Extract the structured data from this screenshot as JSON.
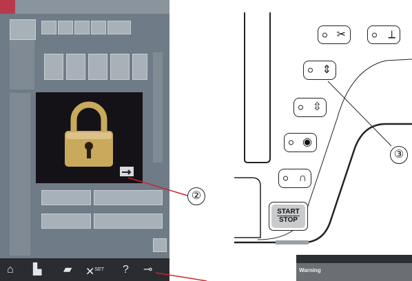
{
  "screen": {
    "bottom_bar": {
      "home_icon": "home-icon",
      "sewing_icon": "sewing-icon",
      "folder_icon": "folder-icon",
      "settings_label": "SET",
      "help_label": "?",
      "key_icon": "key-icon"
    }
  },
  "callouts": {
    "two": "②",
    "three": "③"
  },
  "buttons": {
    "thread_cutter_symbol": "✂",
    "needle_threader_symbol": "⟂",
    "presser_foot_symbol": "⇕",
    "needle_up_down_symbol": "⇳",
    "auto_lock_symbol": "◉",
    "reverse_symbol": "∩",
    "start_stop_line1": "START",
    "start_stop_line2": "STOP"
  },
  "warning_thumb": {
    "title": "Warning"
  },
  "colors": {
    "screen_bg": "#6f7b86",
    "lock_panel_bg": "#141217",
    "lock_gold": "#c9a95c",
    "callout_line": "#d0222a",
    "start_button_fill": "#c9cbcd"
  }
}
